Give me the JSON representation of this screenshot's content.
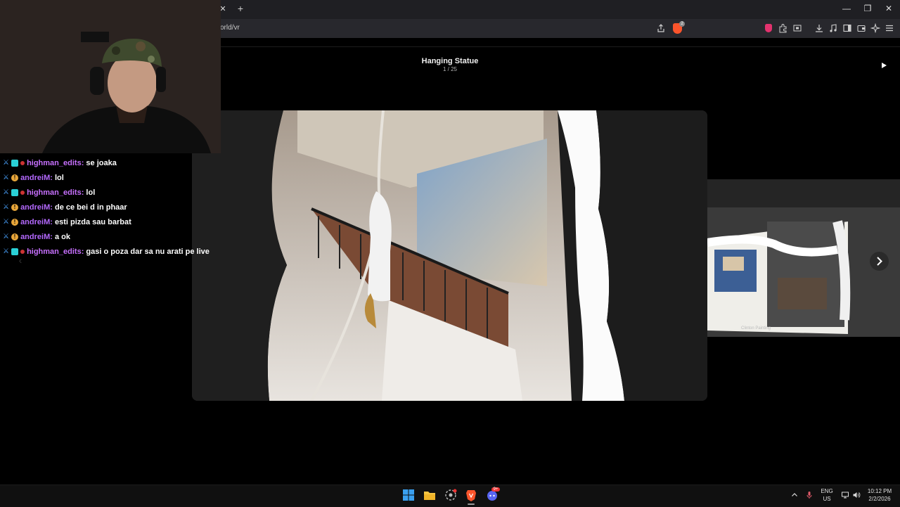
{
  "browser": {
    "tab_close": "✕",
    "new_tab": "+",
    "url": "orld/vr",
    "brave_badge": "2",
    "window_controls": [
      "—",
      "❐",
      "✕"
    ]
  },
  "viewer": {
    "title": "Hanging Statue",
    "counter": "1 / 25",
    "next_caption": "Clinton Painting",
    "play_icon": "play-icon",
    "prev_icon": "chevron-left-icon",
    "next_icon": "chevron-right-icon"
  },
  "chat": {
    "messages": [
      {
        "user": "highman_edits",
        "text": "se joaka"
      },
      {
        "user": "andreiM",
        "text": "lol"
      },
      {
        "user": "highman_edits",
        "text": "lol"
      },
      {
        "user": "andreiM",
        "text": "de ce bei d in phaar"
      },
      {
        "user": "andreiM",
        "text": "esti pizda sau barbat"
      },
      {
        "user": "andreiM",
        "text": "a ok"
      },
      {
        "user": "highman_edits",
        "text": "gasi o poza dar sa nu arati pe live"
      }
    ]
  },
  "taskbar": {
    "apps": [
      "windows-start-icon",
      "file-explorer-icon",
      "chrome-app-icon",
      "brave-app-icon",
      "discord-app-icon"
    ],
    "discord_badge": "9+",
    "language": "ENG",
    "region": "US",
    "time": "10:12 PM",
    "date": "2/2/2026"
  },
  "colors": {
    "chrome_bg": "#1f1f23",
    "toolbar_bg": "#28282d",
    "username_highman": "#c770ff",
    "username_andrei": "#b469ff",
    "brave_orange": "#fb542b"
  }
}
